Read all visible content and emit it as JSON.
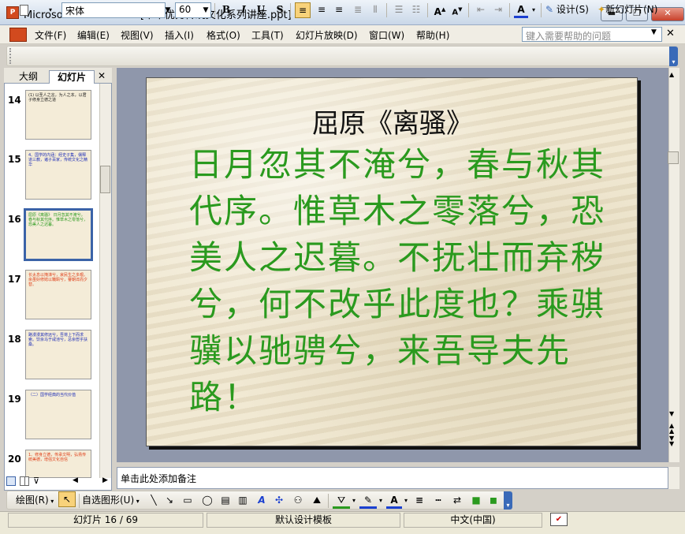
{
  "window": {
    "title": "Microsoft PowerPoint - [中华优秀传统文化系列讲座.ppt]",
    "controls": {
      "minimize": "▬",
      "restore": "❐",
      "close": "✕"
    }
  },
  "menu": {
    "items": [
      "文件(F)",
      "编辑(E)",
      "视图(V)",
      "插入(I)",
      "格式(O)",
      "工具(T)",
      "幻灯片放映(D)",
      "窗口(W)",
      "帮助(H)"
    ],
    "help_placeholder": "键入需要帮助的问题",
    "doc_close": "✕"
  },
  "format_toolbar": {
    "font": "宋体",
    "size": "60",
    "bold": "B",
    "italic": "I",
    "underline": "U",
    "shadow": "S",
    "design_label": "设计(S)",
    "new_slide_label": "新幻灯片(N)"
  },
  "left_pane": {
    "tabs": [
      "大纲",
      "幻灯片"
    ],
    "close": "✕",
    "slides": [
      {
        "number": "14",
        "preview": "(1) 以圣人之言，为人之本，以君子修身立德之道",
        "color": "#1a1a1a"
      },
      {
        "number": "15",
        "preview": "4、国学的内涵：经史子集，儒释道三教，诸子百家，传统文化之精华",
        "color": "#1f2fb8"
      },
      {
        "number": "16",
        "preview": "屈原《离骚》 日月忽其不淹兮，春与秋其代序。惟草木之零落兮，恐美人之迟暮。",
        "color": "#2a9a1e",
        "selected": true
      },
      {
        "number": "17",
        "preview": "长太息以掩涕兮，哀民生之多艰。余虽好修姱以鞿羁兮，謇朝谇而夕替。",
        "color": "#e0401a"
      },
      {
        "number": "18",
        "preview": "路漫漫其修远兮，吾将上下而求索。饮余马于咸池兮，总余辔乎扶桑。",
        "color": "#1f2fb8"
      },
      {
        "number": "19",
        "preview": "（二）国学经典的当代价值",
        "color": "#1f2fb8"
      },
      {
        "number": "20",
        "preview": "1、修身立德，传承文明，弘扬传统美德，增强文化自信",
        "color": "#e0401a"
      }
    ]
  },
  "slide": {
    "title": "屈原《离骚》",
    "body": "日月忽其不淹兮，春与秋其代序。惟草木之零落兮，恐美人之迟暮。不抚壮而弃秽兮，何不改乎此度也？乘骐骥以驰骋兮，来吾导夫先路！",
    "body_color": "#2a9a1e"
  },
  "notes": {
    "placeholder": "单击此处添加备注"
  },
  "draw_toolbar": {
    "draw_label": "绘图(R)",
    "autoshapes_label": "自选图形(U)"
  },
  "status": {
    "slide_counter": "幻灯片 16 / 69",
    "template": "默认设计模板",
    "language": "中文(中国)"
  }
}
